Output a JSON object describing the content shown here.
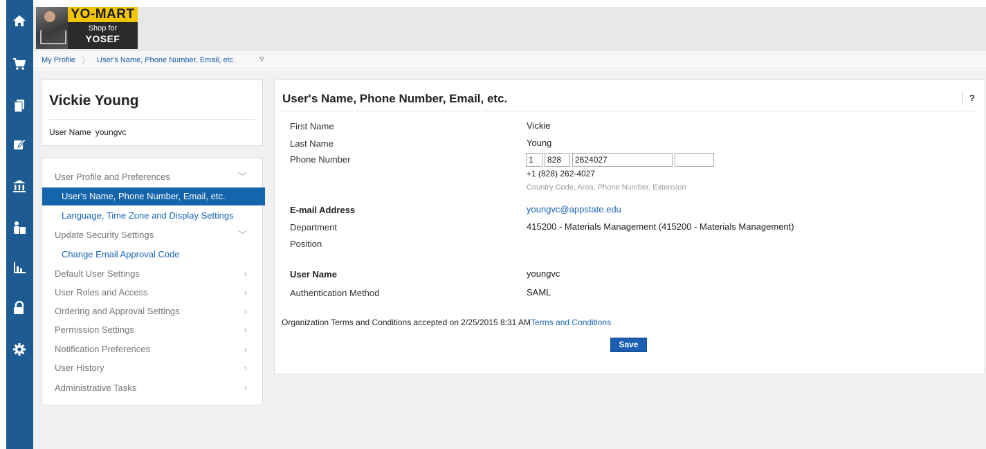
{
  "rail": {
    "icons": [
      "home-icon",
      "cart-icon",
      "documents-icon",
      "edit-icon",
      "bank-icon",
      "people-icon",
      "chart-icon",
      "lock-icon",
      "gear-icon"
    ]
  },
  "logo": {
    "brand": "YO-MART",
    "tagline_top": "Shop for",
    "tagline_bottom": "YOSEF"
  },
  "breadcrumb": {
    "root": "My Profile",
    "current": "User's Name, Phone Number, Email, etc."
  },
  "user_card": {
    "name": "Vickie Young",
    "username_label": "User Name",
    "username_value": "youngvc"
  },
  "nav": {
    "items": [
      {
        "label": "User Profile and Preferences",
        "chevron": "down"
      },
      {
        "label": "User's Name, Phone Number, Email, etc.",
        "active": true
      },
      {
        "label": "Language, Time Zone and Display Settings"
      },
      {
        "label": "Update Security Settings",
        "chevron": "down"
      },
      {
        "label": "Change Email Approval Code"
      },
      {
        "label": "Default User Settings",
        "chevron": "right"
      },
      {
        "label": "User Roles and Access",
        "chevron": "right"
      },
      {
        "label": "Ordering and Approval Settings",
        "chevron": "right"
      },
      {
        "label": "Permission Settings",
        "chevron": "right"
      },
      {
        "label": "Notification Preferences",
        "chevron": "right"
      },
      {
        "label": "User History",
        "chevron": "right"
      },
      {
        "label": "Administrative Tasks",
        "chevron": "right"
      }
    ]
  },
  "main": {
    "title": "User's Name, Phone Number, Email, etc.",
    "help": "?",
    "fields": {
      "first_name_label": "First Name",
      "first_name": "Vickie",
      "last_name_label": "Last Name",
      "last_name": "Young",
      "phone_label": "Phone Number",
      "phone_country": "1",
      "phone_area": "828",
      "phone_number": "2624027",
      "phone_ext": "",
      "phone_formatted": "+1 (828) 262-4027",
      "phone_hint": "Country Code, Area, Phone Number, Extension",
      "email_label": "E-mail Address",
      "email": "youngvc@appstate.edu",
      "department_label": "Department",
      "department": "415200 - Materials Management (415200 - Materials Management)",
      "position_label": "Position",
      "username_label": "User Name",
      "username": "youngvc",
      "auth_label": "Authentication Method",
      "auth": "SAML"
    },
    "terms_text": "Organization Terms and Conditions accepted on 2/25/2015 8:31 AM",
    "terms_link": "Terms and Conditions",
    "save_label": "Save"
  }
}
